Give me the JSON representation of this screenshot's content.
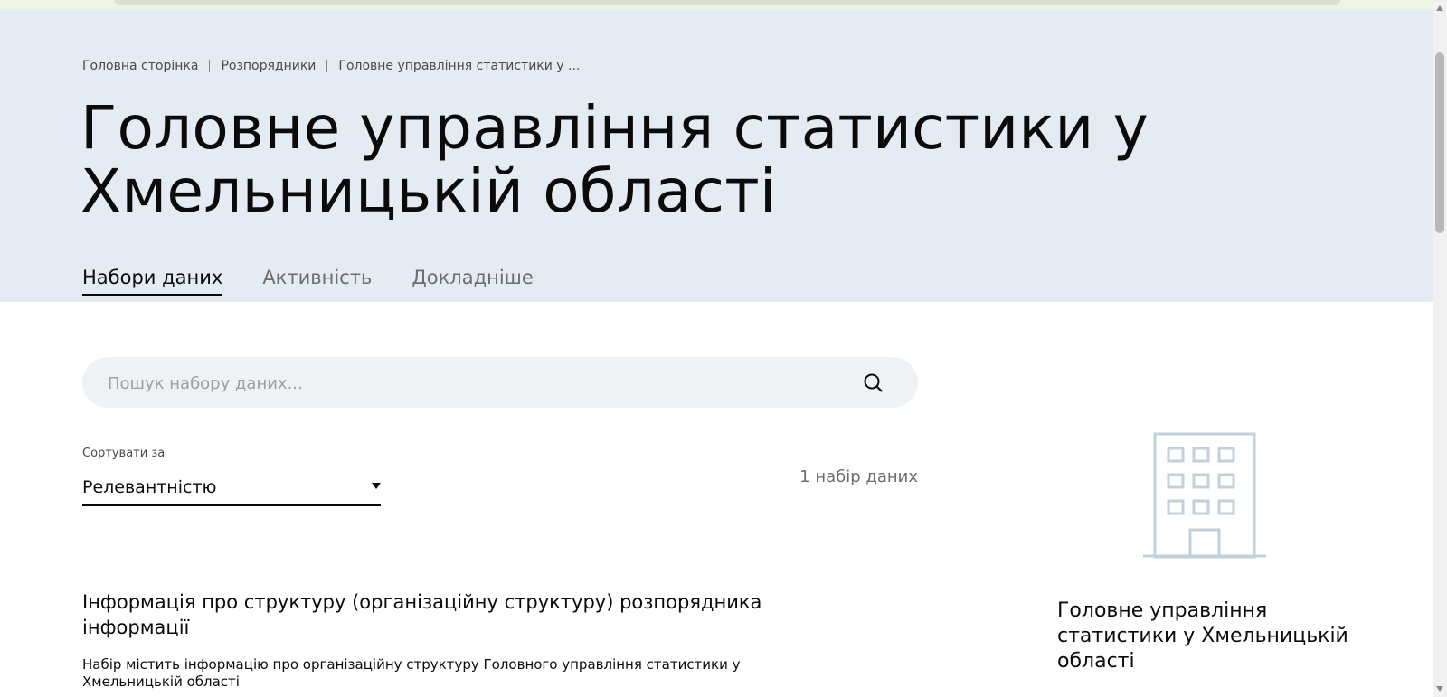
{
  "breadcrumb": {
    "items": [
      "Головна сторінка",
      "Розпорядники",
      "Головне управління статистики у ..."
    ]
  },
  "page": {
    "title": "Головне управління статистики у Хмельницькій області"
  },
  "tabs": [
    {
      "label": "Набори даних",
      "active": true
    },
    {
      "label": "Активність",
      "active": false
    },
    {
      "label": "Докладніше",
      "active": false
    }
  ],
  "search": {
    "placeholder": "Пошук набору даних...",
    "icon": "search-icon"
  },
  "sort": {
    "label": "Сортувати за",
    "selected": "Релевантністю"
  },
  "results": {
    "count_text": "1 набір даних"
  },
  "dataset": {
    "title": "Інформація про структуру (організаційну структуру) розпорядника інформації",
    "description": "Набір містить інформацію про організаційну структуру Головного управління статистики у Хмельницькій області"
  },
  "organization": {
    "icon": "building-icon",
    "name": "Головне управління статистики у Хмельницькій області"
  },
  "colors": {
    "hero_background": "#e4ebf2",
    "search_background": "#eef2f5",
    "icon_stroke": "#c2d0dc",
    "text": "#0b0b0b",
    "muted_text": "#6d6d6d"
  }
}
